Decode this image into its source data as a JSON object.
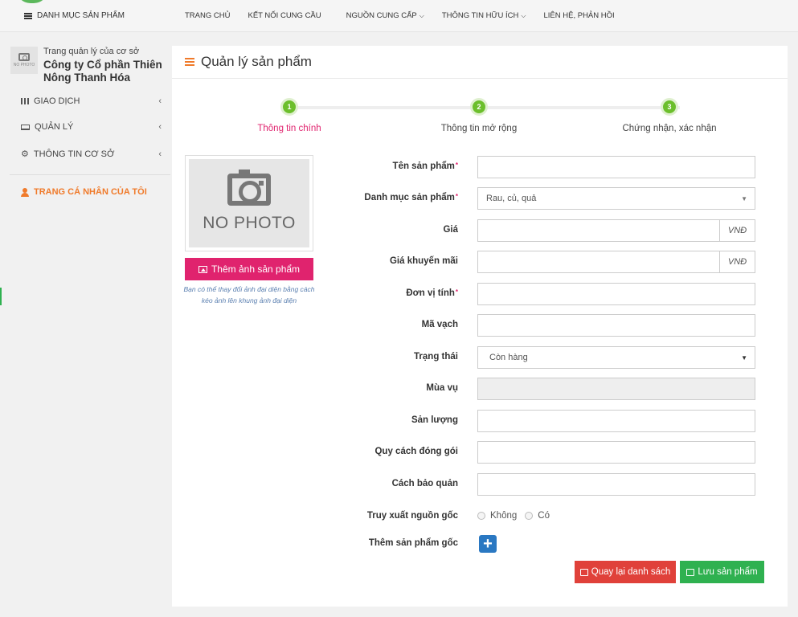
{
  "topnav": {
    "category_button": "DANH MỤC SẢN PHẨM",
    "menu": [
      {
        "label": "TRANG CHỦ",
        "caret": false
      },
      {
        "label": "KẾT NỐI CUNG CẦU",
        "caret": false
      },
      {
        "label": "NGUỒN CUNG CẤP",
        "caret": true
      },
      {
        "label": "THÔNG TIN HỮU ÍCH",
        "caret": true
      },
      {
        "label": "LIÊN HỆ, PHẢN HỒI",
        "caret": false
      }
    ]
  },
  "sidebar": {
    "thumb_text": "NO PHOTO",
    "subtitle": "Trang quản lý của cơ sở",
    "company": "Công ty Cổ phần Thiên Nông Thanh Hóa",
    "items": [
      {
        "label": "GIAO DỊCH",
        "icon": "grid-icon"
      },
      {
        "label": "QUẢN LÝ",
        "icon": "laptop-icon"
      },
      {
        "label": "THÔNG TIN CƠ SỞ",
        "icon": "cogs-icon"
      }
    ],
    "profile_link": "TRANG CÁ NHÂN CỦA TÔI"
  },
  "panel": {
    "title": "Quản lý sản phẩm",
    "steps": [
      {
        "num": "1",
        "label": "Thông tin chính",
        "active": true
      },
      {
        "num": "2",
        "label": "Thông tin mở rộng",
        "active": false
      },
      {
        "num": "3",
        "label": "Chứng nhận, xác nhận",
        "active": false
      }
    ],
    "image": {
      "placeholder": "NO PHOTO",
      "add_button": "Thêm ảnh sản phẩm",
      "note": "Bạn có thể thay đổi ảnh đại diện bằng cách kéo ảnh lên khung ảnh đại diện"
    },
    "form": {
      "name_label": "Tên sản phẩm",
      "name_value": "",
      "category_label": "Danh mục sản phẩm",
      "category_value": "Rau, củ, quả",
      "price_label": "Giá",
      "price_value": "",
      "price_unit": "VNĐ",
      "sale_label": "Giá khuyến mãi",
      "sale_value": "",
      "sale_unit": "VNĐ",
      "unit_label": "Đơn vị tính",
      "unit_value": "",
      "barcode_label": "Mã vạch",
      "barcode_value": "",
      "status_label": "Trạng thái",
      "status_value": "Còn hàng",
      "season_label": "Mùa vụ",
      "season_value": "",
      "output_label": "Sản lượng",
      "output_value": "",
      "packing_label": "Quy cách đóng gói",
      "packing_value": "",
      "storage_label": "Cách bảo quản",
      "storage_value": "",
      "trace_label": "Truy xuất nguồn gốc",
      "trace_no": "Không",
      "trace_yes": "Có",
      "origin_label": "Thêm sản phẩm gốc"
    },
    "buttons": {
      "back": "Quay lại danh sách",
      "save": "Lưu sản phẩm"
    },
    "colors": {
      "accent_orange": "#f07a2a",
      "step_green": "#6cbf2c",
      "pink": "#e0236e",
      "red": "#e0413a",
      "green": "#2fb150",
      "blue": "#2a78c2"
    }
  }
}
